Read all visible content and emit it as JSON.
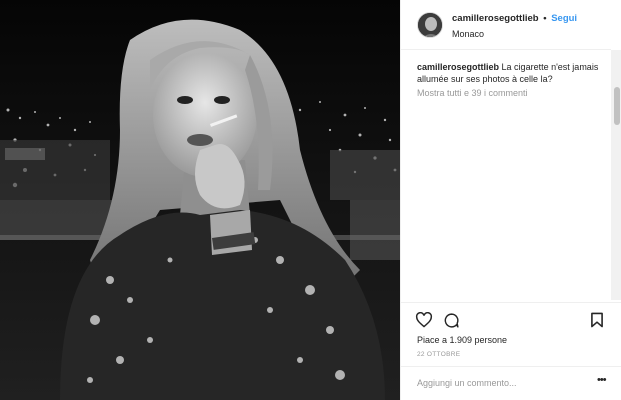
{
  "post": {
    "username": "camillerosegottlieb",
    "separator": "•",
    "follow_label": "Segui",
    "location": "Monaco",
    "caption_user": "camillerosegottlieb",
    "caption_text": "La cigarette n'est jamais allumée sur ses photos à celle la?",
    "view_comments": "Mostra tutti e 39 i commenti",
    "likes": "Piace a 1.909 persone",
    "date": "22 OTTOBRE",
    "comment_placeholder": "Aggiungi un commento...",
    "more_options": "•••"
  },
  "icons": {
    "like": "heart-icon",
    "comment": "comment-bubble-icon",
    "save": "bookmark-icon"
  },
  "colors": {
    "follow": "#3897f0",
    "text": "#262626",
    "muted": "#999999"
  }
}
